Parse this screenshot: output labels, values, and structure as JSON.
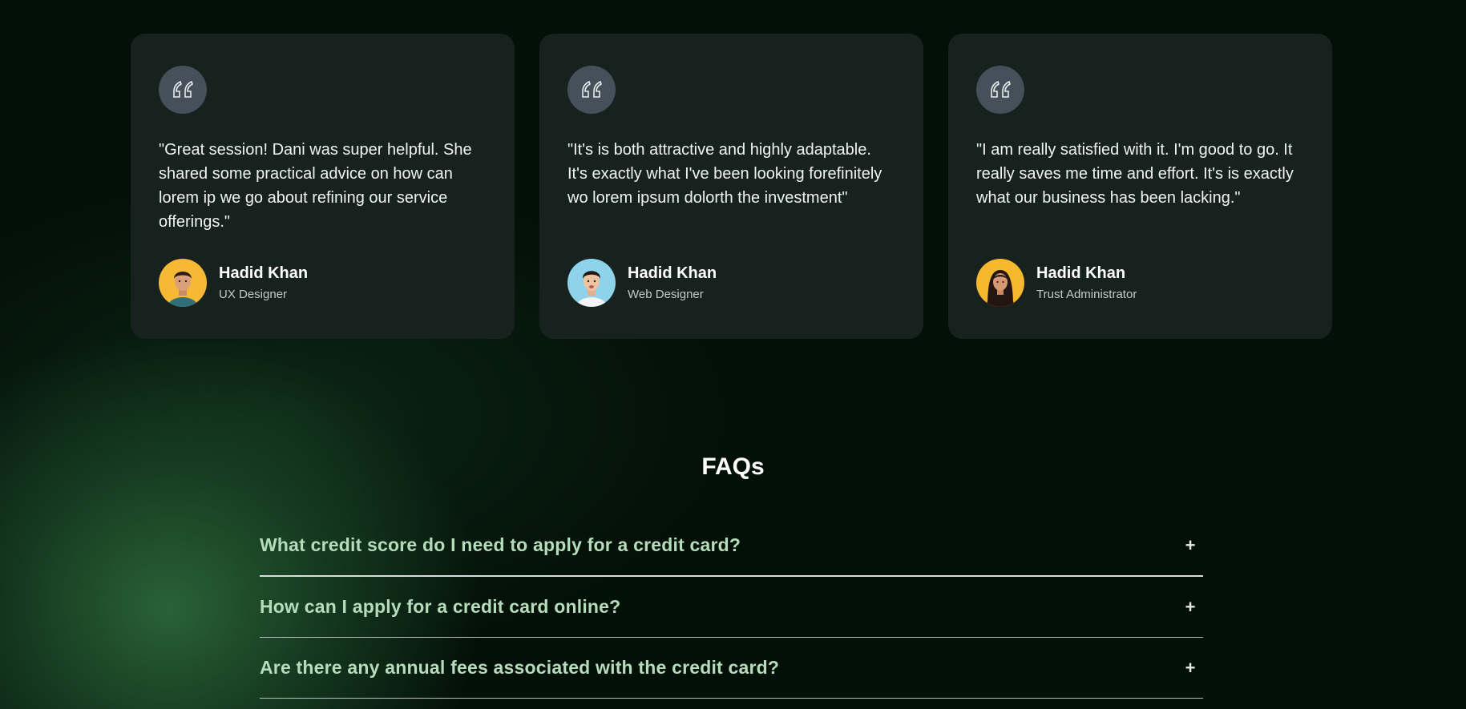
{
  "testimonials": [
    {
      "text": "\"Great session! Dani was super helpful. She shared some practical advice on how can lorem ip we go about refining our service offerings.\"",
      "name": "Hadid Khan",
      "role": "UX Designer",
      "avatar_bg": "#f7b833"
    },
    {
      "text": "\"It's is both attractive and highly adaptable. It's exactly what I've been looking forefinitely wo lorem ipsum dolorth the investment\"",
      "name": "Hadid Khan",
      "role": "Web Designer",
      "avatar_bg": "#8fd3ea"
    },
    {
      "text": "\"I am really satisfied with it. I'm good to go. It really saves me time and effort. It's is exactly what our business has been lacking.\"",
      "name": "Hadid Khan",
      "role": "Trust Administrator",
      "avatar_bg": "#f5b82e"
    }
  ],
  "faq": {
    "title": "FAQs",
    "toggle_symbol": "+",
    "items": [
      {
        "question": "What credit score do I need to apply for a credit card?"
      },
      {
        "question": "How can I apply for a credit card online?"
      },
      {
        "question": "Are there any annual fees associated with the credit card?"
      }
    ]
  },
  "colors": {
    "background": "#031008",
    "card": "#17221f",
    "quote_badge": "#46505a",
    "faq_question": "#b6dcbc",
    "glow": "#2f6b3e"
  },
  "icons": {
    "quote": "quote-icon",
    "toggle": "plus-icon"
  }
}
